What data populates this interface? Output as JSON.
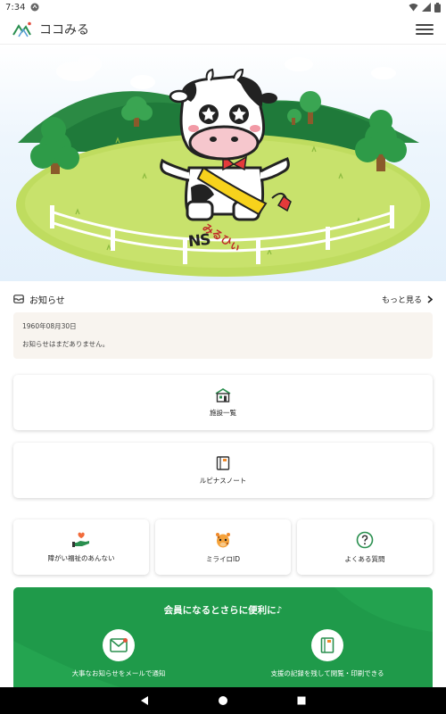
{
  "status_bar": {
    "time": "7:34"
  },
  "app": {
    "title": "ココみる"
  },
  "news": {
    "heading": "お知らせ",
    "more_label": "もっと見る",
    "date": "1960年08月30日",
    "message": "お知らせはまだありません。"
  },
  "cards": {
    "facilities": "施設一覧",
    "lupinus_note": "ルピナスノート",
    "welfare_guide": "障がい福祉のあんない",
    "mirairo_id": "ミライロID",
    "faq": "よくある質問"
  },
  "mascot": {
    "sash_text": "みるひぃ",
    "belly_text": "NS"
  },
  "member": {
    "title": "会員になるとさらに便利に♪",
    "feature_email": "大事なお知らせをメールで通知",
    "feature_records": "支援の記録を残して閲覧・印刷できる"
  },
  "colors": {
    "accent_green": "#1f9a4a",
    "news_bg": "#f8f4ef"
  }
}
